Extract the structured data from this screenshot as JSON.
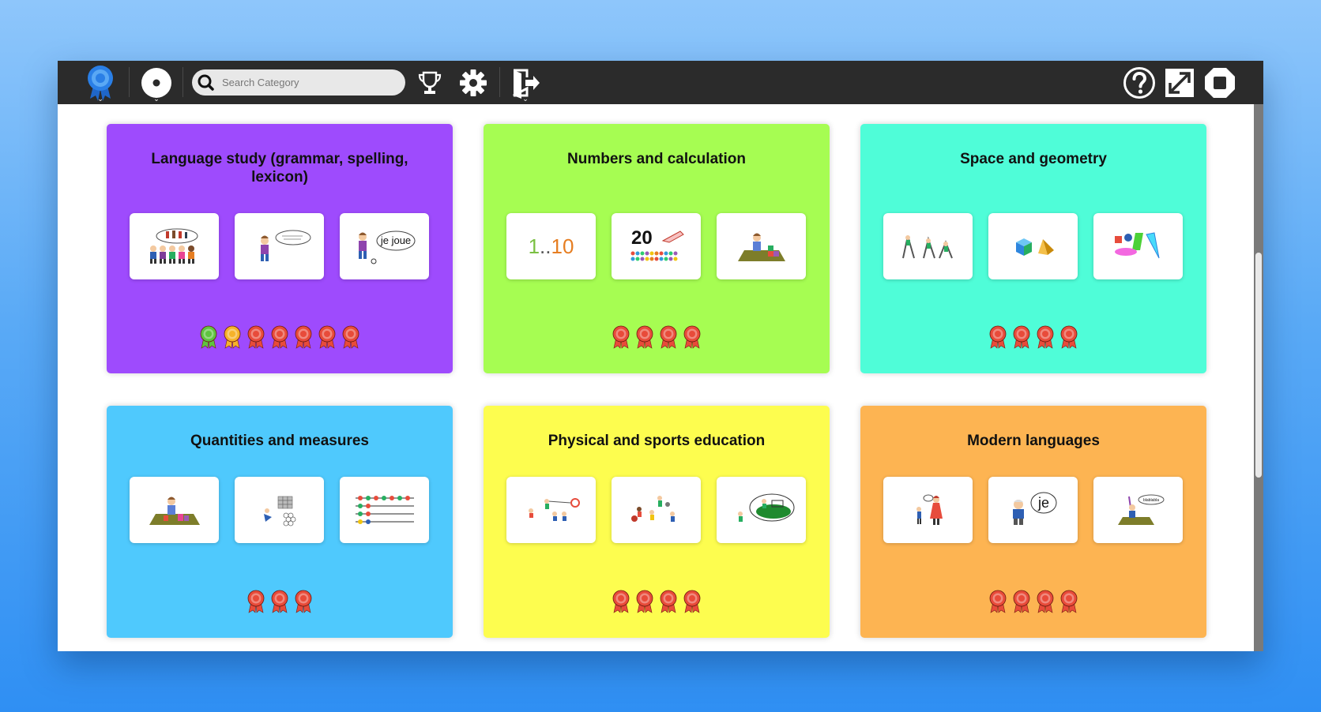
{
  "toolbar": {
    "search_placeholder": "Search Category",
    "icons": [
      "award-menu-icon",
      "disc-menu-icon",
      "search-icon",
      "trophy-icon",
      "gear-icon",
      "exit-icon",
      "help-icon",
      "fullscreen-icon",
      "stop-icon"
    ]
  },
  "colors": {
    "language": "#9e4bfd",
    "numbers": "#a6fd52",
    "space": "#4ffdd8",
    "quantities": "#4fc9fd",
    "sports": "#fdfd4f",
    "modern": "#fdb452",
    "award_red": "#e84b3a",
    "award_green": "#5ec43f",
    "award_gold": "#f5b22a"
  },
  "categories": [
    {
      "title": "Language study (grammar, spelling, lexicon)",
      "awards": [
        "green",
        "gold",
        "red",
        "red",
        "red",
        "red",
        "red"
      ],
      "tiles": [
        {
          "icon": "children-group-icon"
        },
        {
          "icon": "speech-kid-icon",
          "text": "Avez fait... font... font..."
        },
        {
          "icon": "kid-speech-bubble-icon",
          "text": "je joue"
        }
      ]
    },
    {
      "title": "Numbers and calculation",
      "awards": [
        "red",
        "red",
        "red",
        "red"
      ],
      "tiles": [
        {
          "icon": "counting-icon",
          "text_a": "1",
          "text_b": "..",
          "text_c": "10"
        },
        {
          "icon": "twenty-beads-icon",
          "text": "20"
        },
        {
          "icon": "kid-blocks-icon"
        }
      ]
    },
    {
      "title": "Space and geometry",
      "awards": [
        "red",
        "red",
        "red",
        "red"
      ],
      "tiles": [
        {
          "icon": "kids-climbing-icon"
        },
        {
          "icon": "cube-pyramid-icon"
        },
        {
          "icon": "colored-shapes-icon"
        }
      ]
    },
    {
      "title": "Quantities and measures",
      "awards": [
        "red",
        "red",
        "red"
      ],
      "tiles": [
        {
          "icon": "kid-weights-icon"
        },
        {
          "icon": "stacks-icon"
        },
        {
          "icon": "abacus-icon"
        }
      ]
    },
    {
      "title": "Physical and sports education",
      "awards": [
        "red",
        "red",
        "red",
        "red"
      ],
      "tiles": [
        {
          "icon": "archery-kids-icon"
        },
        {
          "icon": "ball-game-icon"
        },
        {
          "icon": "football-field-icon"
        }
      ]
    },
    {
      "title": "Modern languages",
      "awards": [
        "red",
        "red",
        "red",
        "red"
      ],
      "tiles": [
        {
          "icon": "teacher-kid-icon"
        },
        {
          "icon": "grandpa-je-icon",
          "text": "je"
        },
        {
          "icon": "kid-blackboard-icon",
          "text": "blablabla"
        }
      ]
    }
  ]
}
